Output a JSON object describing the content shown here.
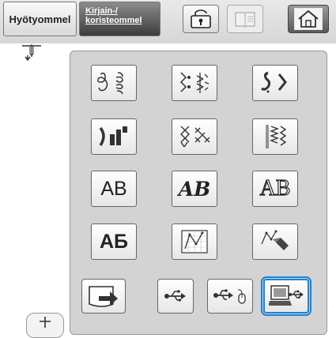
{
  "tabs": {
    "utility_label": "Hyötyommel",
    "character_label_line1": "Kirjain-/",
    "character_label_line2": "koristeommel"
  },
  "toolbar": {
    "lock_icon": "lock-icon",
    "book_icon": "book-icon",
    "home_icon": "home-icon"
  },
  "stitch_buttons": [
    {
      "name": "decorative-flourish-pattern"
    },
    {
      "name": "floral-pattern"
    },
    {
      "name": "satin-pattern"
    },
    {
      "name": "step-satin-pattern"
    },
    {
      "name": "cross-stitch-pattern"
    },
    {
      "name": "utility-decorative-pattern"
    },
    {
      "name": "gothic-font",
      "text": "AB"
    },
    {
      "name": "script-font",
      "text": "AB"
    },
    {
      "name": "outline-font",
      "text": "AB"
    },
    {
      "name": "cyrillic-font",
      "text": "АБ"
    },
    {
      "name": "my-custom-stitch"
    },
    {
      "name": "custom-stitch-edit"
    }
  ],
  "retrieve_buttons": [
    {
      "name": "pocket-recall"
    },
    {
      "name": "usb-media"
    },
    {
      "name": "usb-mouse"
    },
    {
      "name": "computer-usb",
      "selected": true
    }
  ],
  "colors": {
    "selection": "#1a84d8",
    "panel": "#d3d3d3"
  }
}
